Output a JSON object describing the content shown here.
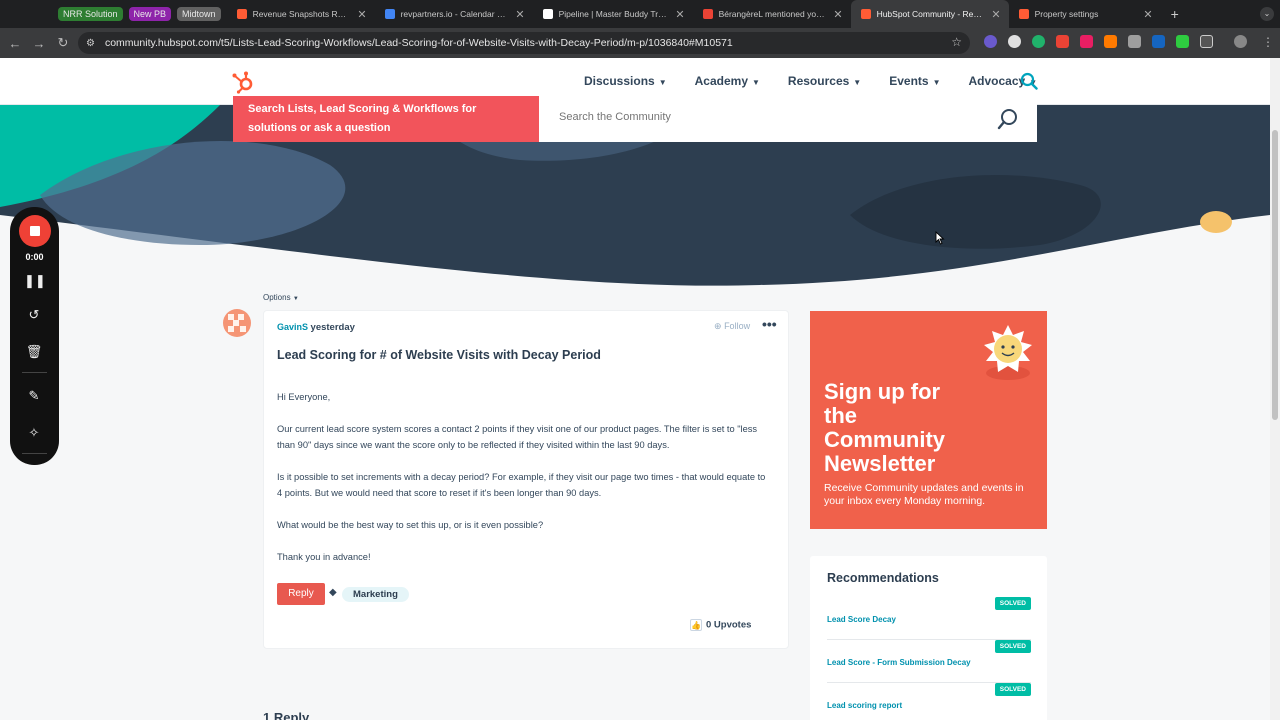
{
  "browser": {
    "tab_groups": [
      "NRR Solution",
      "New PB",
      "Midtown"
    ],
    "tabs": [
      {
        "title": "Revenue Snapshots Roll-up",
        "favicon_color": "#ff5c35"
      },
      {
        "title": "revpartners.io - Calendar - Week",
        "favicon_color": "#4285f4"
      },
      {
        "title": "Pipeline | Master Buddy Tracker",
        "favicon_color": "#ffffff"
      },
      {
        "title": "BérangèreL mentioned you in",
        "favicon_color": "#ea4335"
      },
      {
        "title": "HubSpot Community - Re: Lead",
        "favicon_color": "#ff5c35"
      },
      {
        "title": "Property settings",
        "favicon_color": "#ff5c35"
      }
    ],
    "new_tab": "+",
    "url": "community.hubspot.com/t5/Lists-Lead-Scoring-Workflows/Lead-Scoring-for-of-Website-Visits-with-Decay-Period/m-p/1036840#M10571"
  },
  "header": {
    "menu": [
      "Discussions",
      "Academy",
      "Resources",
      "Events",
      "Advocacy"
    ]
  },
  "hero": {
    "search_prompt": "Search Lists, Lead Scoring & Workflows for solutions or ask a question",
    "search_placeholder": "Search the Community"
  },
  "recorder": {
    "time": "0:00"
  },
  "post": {
    "options": "Options",
    "author": "GavinS",
    "date": "yesterday",
    "follow": "Follow",
    "title": "Lead Scoring for # of Website Visits with Decay Period",
    "paragraphs": [
      "Hi Everyone,",
      "Our current lead score system scores a contact 2 points if they visit one of our product pages. The filter is set to \"less than 90\" days since we want the score only to be reflected if they visited within the last 90 days.",
      "Is it possible to set increments with a decay period? For example, if they visit our page two times - that would equate to 4 points. But we would need that score to reset if it's been longer than 90 days.",
      "What would be the best way to set this up, or is it even possible?",
      "Thank you in advance!"
    ],
    "reply_label": "Reply",
    "tag": "Marketing",
    "upvotes": "0 Upvotes"
  },
  "replies_heading": "1 Reply",
  "sidebar": {
    "promo_title": "Sign up for the Community Newsletter",
    "promo_subtitle": "Receive Community updates and events in your inbox every Monday morning.",
    "recommendations_title": "Recommendations",
    "recommendations": [
      {
        "title": "Lead Score Decay",
        "badge": "SOLVED"
      },
      {
        "title": "Lead Score - Form Submission Decay",
        "badge": "SOLVED"
      },
      {
        "title": "Lead scoring report",
        "badge": "SOLVED"
      }
    ]
  },
  "colors": {
    "brand": "#ff5c35",
    "hero_bg": "#2d3e50",
    "accent_teal": "#00bda5",
    "promo": "#f0614b"
  }
}
